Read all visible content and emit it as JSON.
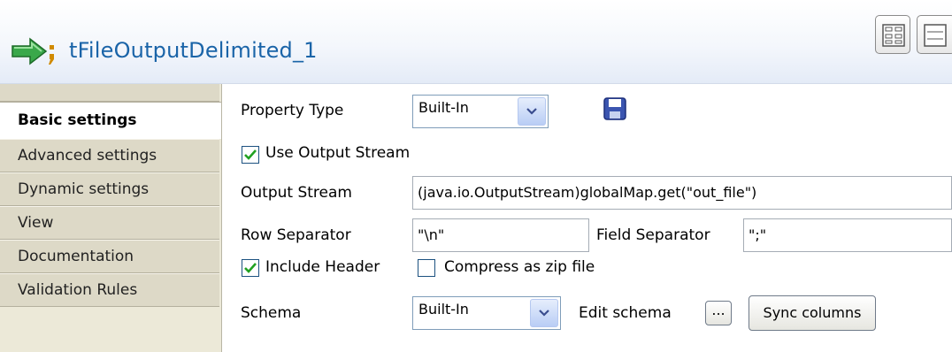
{
  "header": {
    "component_icon": "file-output-arrow-icon",
    "title": "tFileOutputDelimited_1",
    "view_buttons": [
      "grid-layout-icon",
      "list-layout-icon"
    ]
  },
  "sidebar": {
    "items": [
      {
        "label": "Basic settings",
        "active": true
      },
      {
        "label": "Advanced settings",
        "active": false
      },
      {
        "label": "Dynamic settings",
        "active": false
      },
      {
        "label": "View",
        "active": false
      },
      {
        "label": "Documentation",
        "active": false
      },
      {
        "label": "Validation Rules",
        "active": false
      }
    ]
  },
  "form": {
    "property_type": {
      "label": "Property Type",
      "value": "Built-In",
      "save_icon": "save-icon"
    },
    "use_output_stream": {
      "label": "Use Output Stream",
      "checked": true
    },
    "output_stream": {
      "label": "Output Stream",
      "value": "(java.io.OutputStream)globalMap.get(\"out_file\")"
    },
    "row_separator": {
      "label": "Row Separator",
      "value": "\"\\n\""
    },
    "field_separator": {
      "label": "Field Separator",
      "value": "\";\""
    },
    "include_header": {
      "label": "Include Header",
      "checked": true
    },
    "compress": {
      "label": "Compress as zip file",
      "checked": false
    },
    "schema": {
      "label": "Schema",
      "value": "Built-In",
      "edit_label": "Edit schema",
      "ellipsis": "...",
      "sync_label": "Sync columns"
    }
  },
  "colors": {
    "title": "#1a64a8",
    "sidebar": "#ece9d8",
    "check": "#21a121"
  }
}
